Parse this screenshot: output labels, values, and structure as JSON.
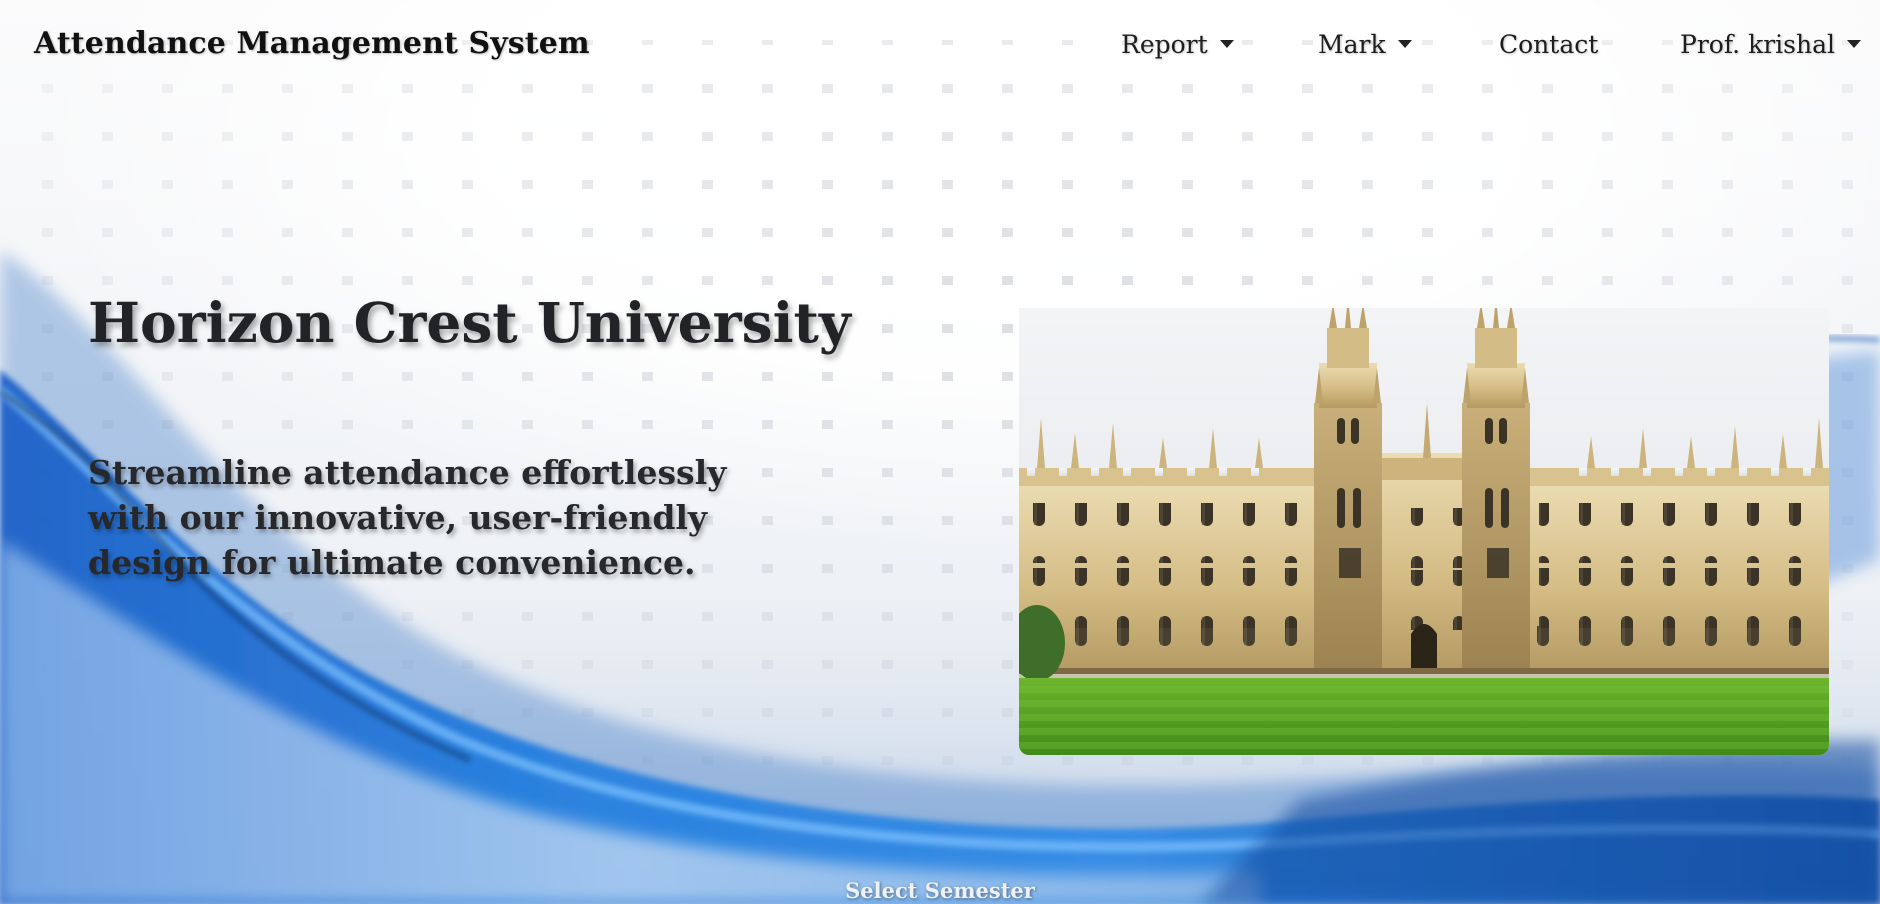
{
  "navbar": {
    "brand": "Attendance Management System",
    "items": [
      {
        "label": "Report",
        "has_dropdown": true
      },
      {
        "label": "Mark",
        "has_dropdown": true
      },
      {
        "label": "Contact",
        "has_dropdown": false
      },
      {
        "label": "Prof. krishal",
        "has_dropdown": true
      }
    ]
  },
  "hero": {
    "title": "Horizon Crest University",
    "tagline": "Streamline attendance effortlessly with our innovative, user-friendly design for ultimate convenience."
  },
  "campus_image": {
    "icon": "university-building-image"
  },
  "footer": {
    "select_semester_label": "Select Semester"
  },
  "colors": {
    "accent_blue": "#1e78d8",
    "dark_blue": "#0a3f8c",
    "text_dark": "#222327",
    "lawn_green": "#5aa028",
    "stone": "#d9c48e"
  }
}
